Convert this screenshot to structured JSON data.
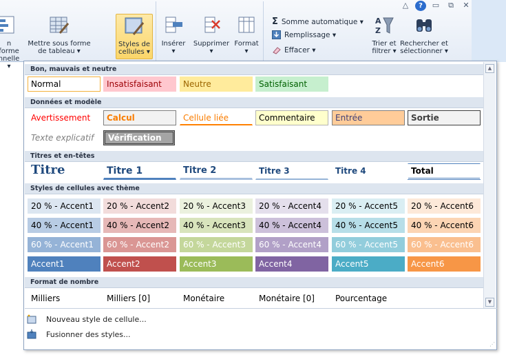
{
  "ribbon": {
    "buttons": {
      "format_conditional": {
        "line1": "n forme",
        "line2": "nnelle ▾"
      },
      "format_table": {
        "line1": "Mettre sous forme",
        "line2": "de tableau ▾"
      },
      "cell_styles": {
        "line1": "Styles de",
        "line2": "cellules ▾"
      },
      "insert": {
        "line1": "Insérer",
        "line2": "▾"
      },
      "delete": {
        "line1": "Supprimer",
        "line2": "▾"
      },
      "format": {
        "line1": "Format",
        "line2": "▾"
      },
      "sort_filter": {
        "line1": "Trier et",
        "line2": "filtrer ▾"
      },
      "find_select": {
        "line1": "Rechercher et",
        "line2": "sélectionner ▾"
      }
    },
    "editing": {
      "autosum": "Somme automatique ▾",
      "fill": "Remplissage ▾",
      "clear": "Effacer ▾"
    }
  },
  "gallery": {
    "sections": [
      {
        "title": "Bon, mauvais et neutre"
      },
      {
        "title": "Données et modèle"
      },
      {
        "title": "Titres et en-têtes"
      },
      {
        "title": "Styles de cellules avec thème"
      },
      {
        "title": "Format de nombre"
      }
    ],
    "good_bad": [
      "Normal",
      "Insatisfaisant",
      "Neutre",
      "Satisfaisant"
    ],
    "data_model": [
      "Avertissement",
      "Calcul",
      "Cellule liée",
      "Commentaire",
      "Entrée",
      "Sortie",
      "Texte explicatif",
      "Vérification"
    ],
    "titles": [
      "Titre",
      "Titre 1",
      "Titre 2",
      "Titre 3",
      "Titre 4",
      "Total"
    ],
    "theme": {
      "row20": [
        "20 % - Accent1",
        "20 % - Accent2",
        "20 % - Accent3",
        "20 % - Accent4",
        "20 % - Accent5",
        "20 % - Accent6"
      ],
      "row40": [
        "40 % - Accent1",
        "40 % - Accent2",
        "40 % - Accent3",
        "40 % - Accent4",
        "40 % - Accent5",
        "40 % - Accent6"
      ],
      "row60": [
        "60 % - Accent1",
        "60 % - Accent2",
        "60 % - Accent3",
        "60 % - Accent4",
        "60 % - Accent5",
        "60 % - Accent6"
      ],
      "row100": [
        "Accent1",
        "Accent2",
        "Accent3",
        "Accent4",
        "Accent5",
        "Accent6"
      ]
    },
    "number_format": [
      "Milliers",
      "Milliers [0]",
      "Monétaire",
      "Monétaire [0]",
      "Pourcentage"
    ]
  },
  "menu": {
    "new_style": "Nouveau style de cellule...",
    "merge_styles": "Fusionner des styles..."
  },
  "colors": {
    "accent": [
      "#4f81bd",
      "#c0504d",
      "#9bbb59",
      "#8064a2",
      "#4bacc6",
      "#f79646"
    ],
    "accent20": [
      "#dce6f1",
      "#f2dcdb",
      "#ebf1de",
      "#e4dfec",
      "#daeef3",
      "#fde9d9"
    ],
    "accent40": [
      "#b8cce4",
      "#e6b8b7",
      "#d8e4bc",
      "#ccc0da",
      "#b7dee8",
      "#fcd5b4"
    ],
    "accent60": [
      "#95b3d7",
      "#da9694",
      "#c4d79b",
      "#b1a0c7",
      "#92cddc",
      "#fabf8f"
    ]
  }
}
